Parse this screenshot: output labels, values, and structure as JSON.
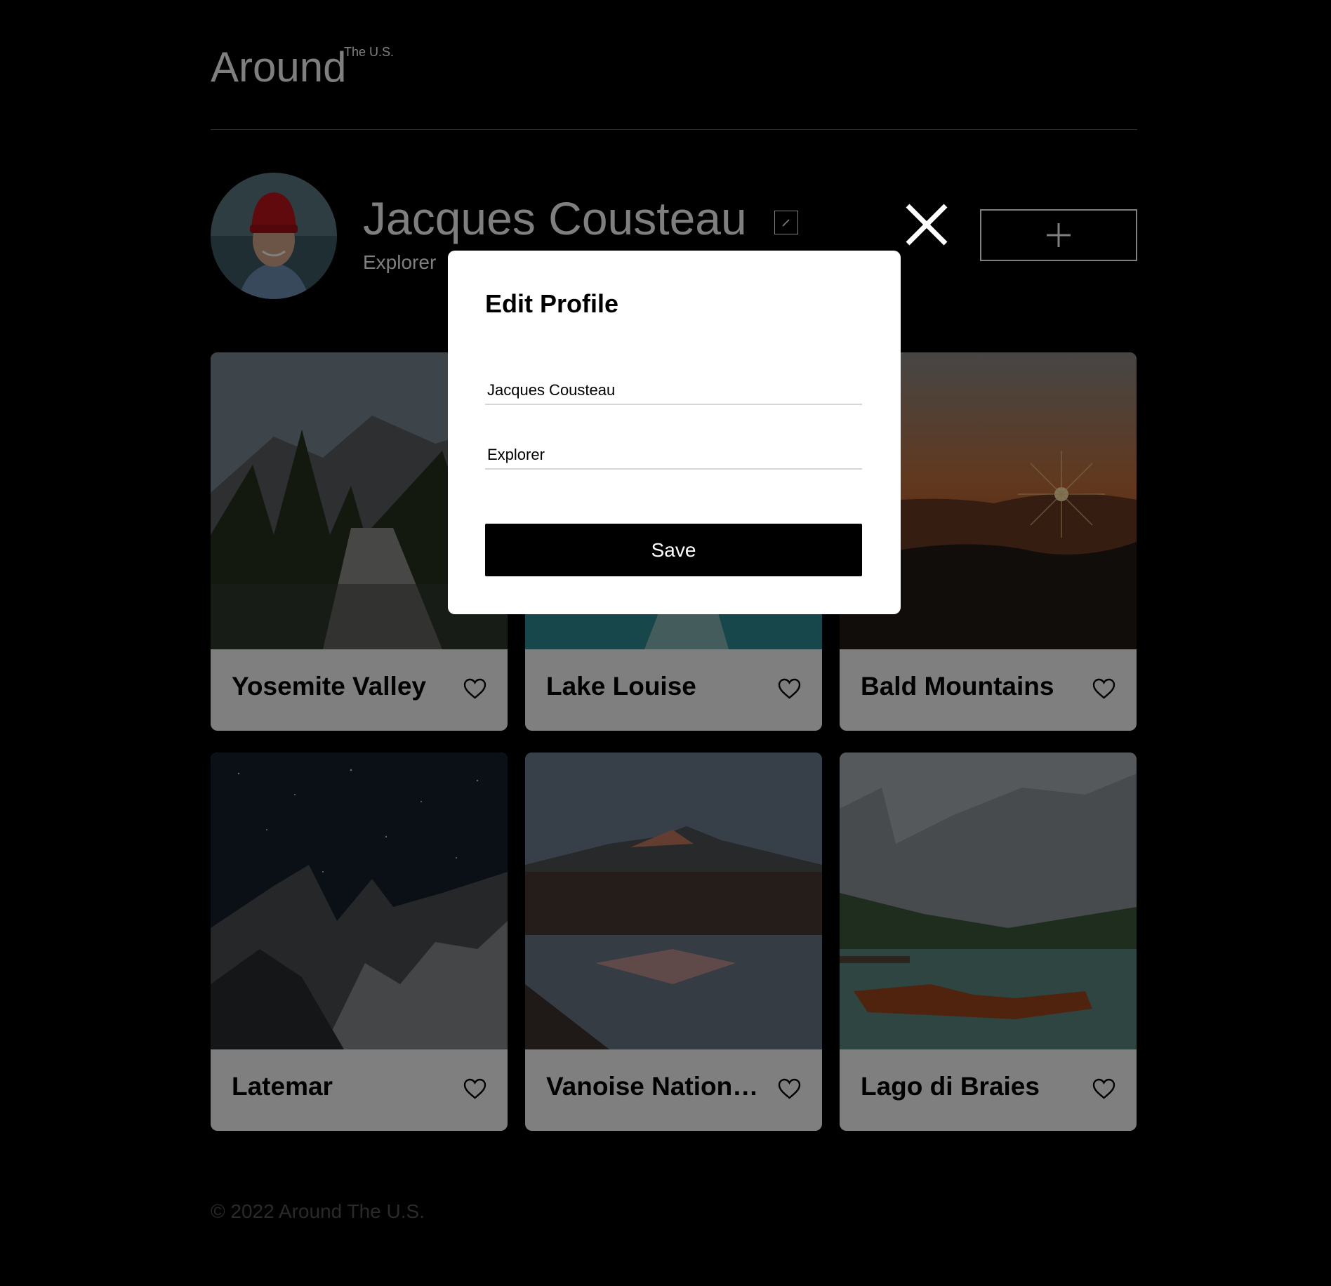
{
  "header": {
    "logo": "Around",
    "logo_sup": "The U.S."
  },
  "profile": {
    "name": "Jacques Cousteau",
    "about": "Explorer"
  },
  "cards": [
    {
      "title": "Yosemite Valley"
    },
    {
      "title": "Lake Louise"
    },
    {
      "title": "Bald Mountains"
    },
    {
      "title": "Latemar"
    },
    {
      "title": "Vanoise Nation…"
    },
    {
      "title": "Lago di Braies"
    }
  ],
  "footer": {
    "text": "© 2022 Around The U.S."
  },
  "modal": {
    "title": "Edit Profile",
    "name_value": "Jacques Cousteau",
    "about_value": "Explorer",
    "save_label": "Save"
  }
}
